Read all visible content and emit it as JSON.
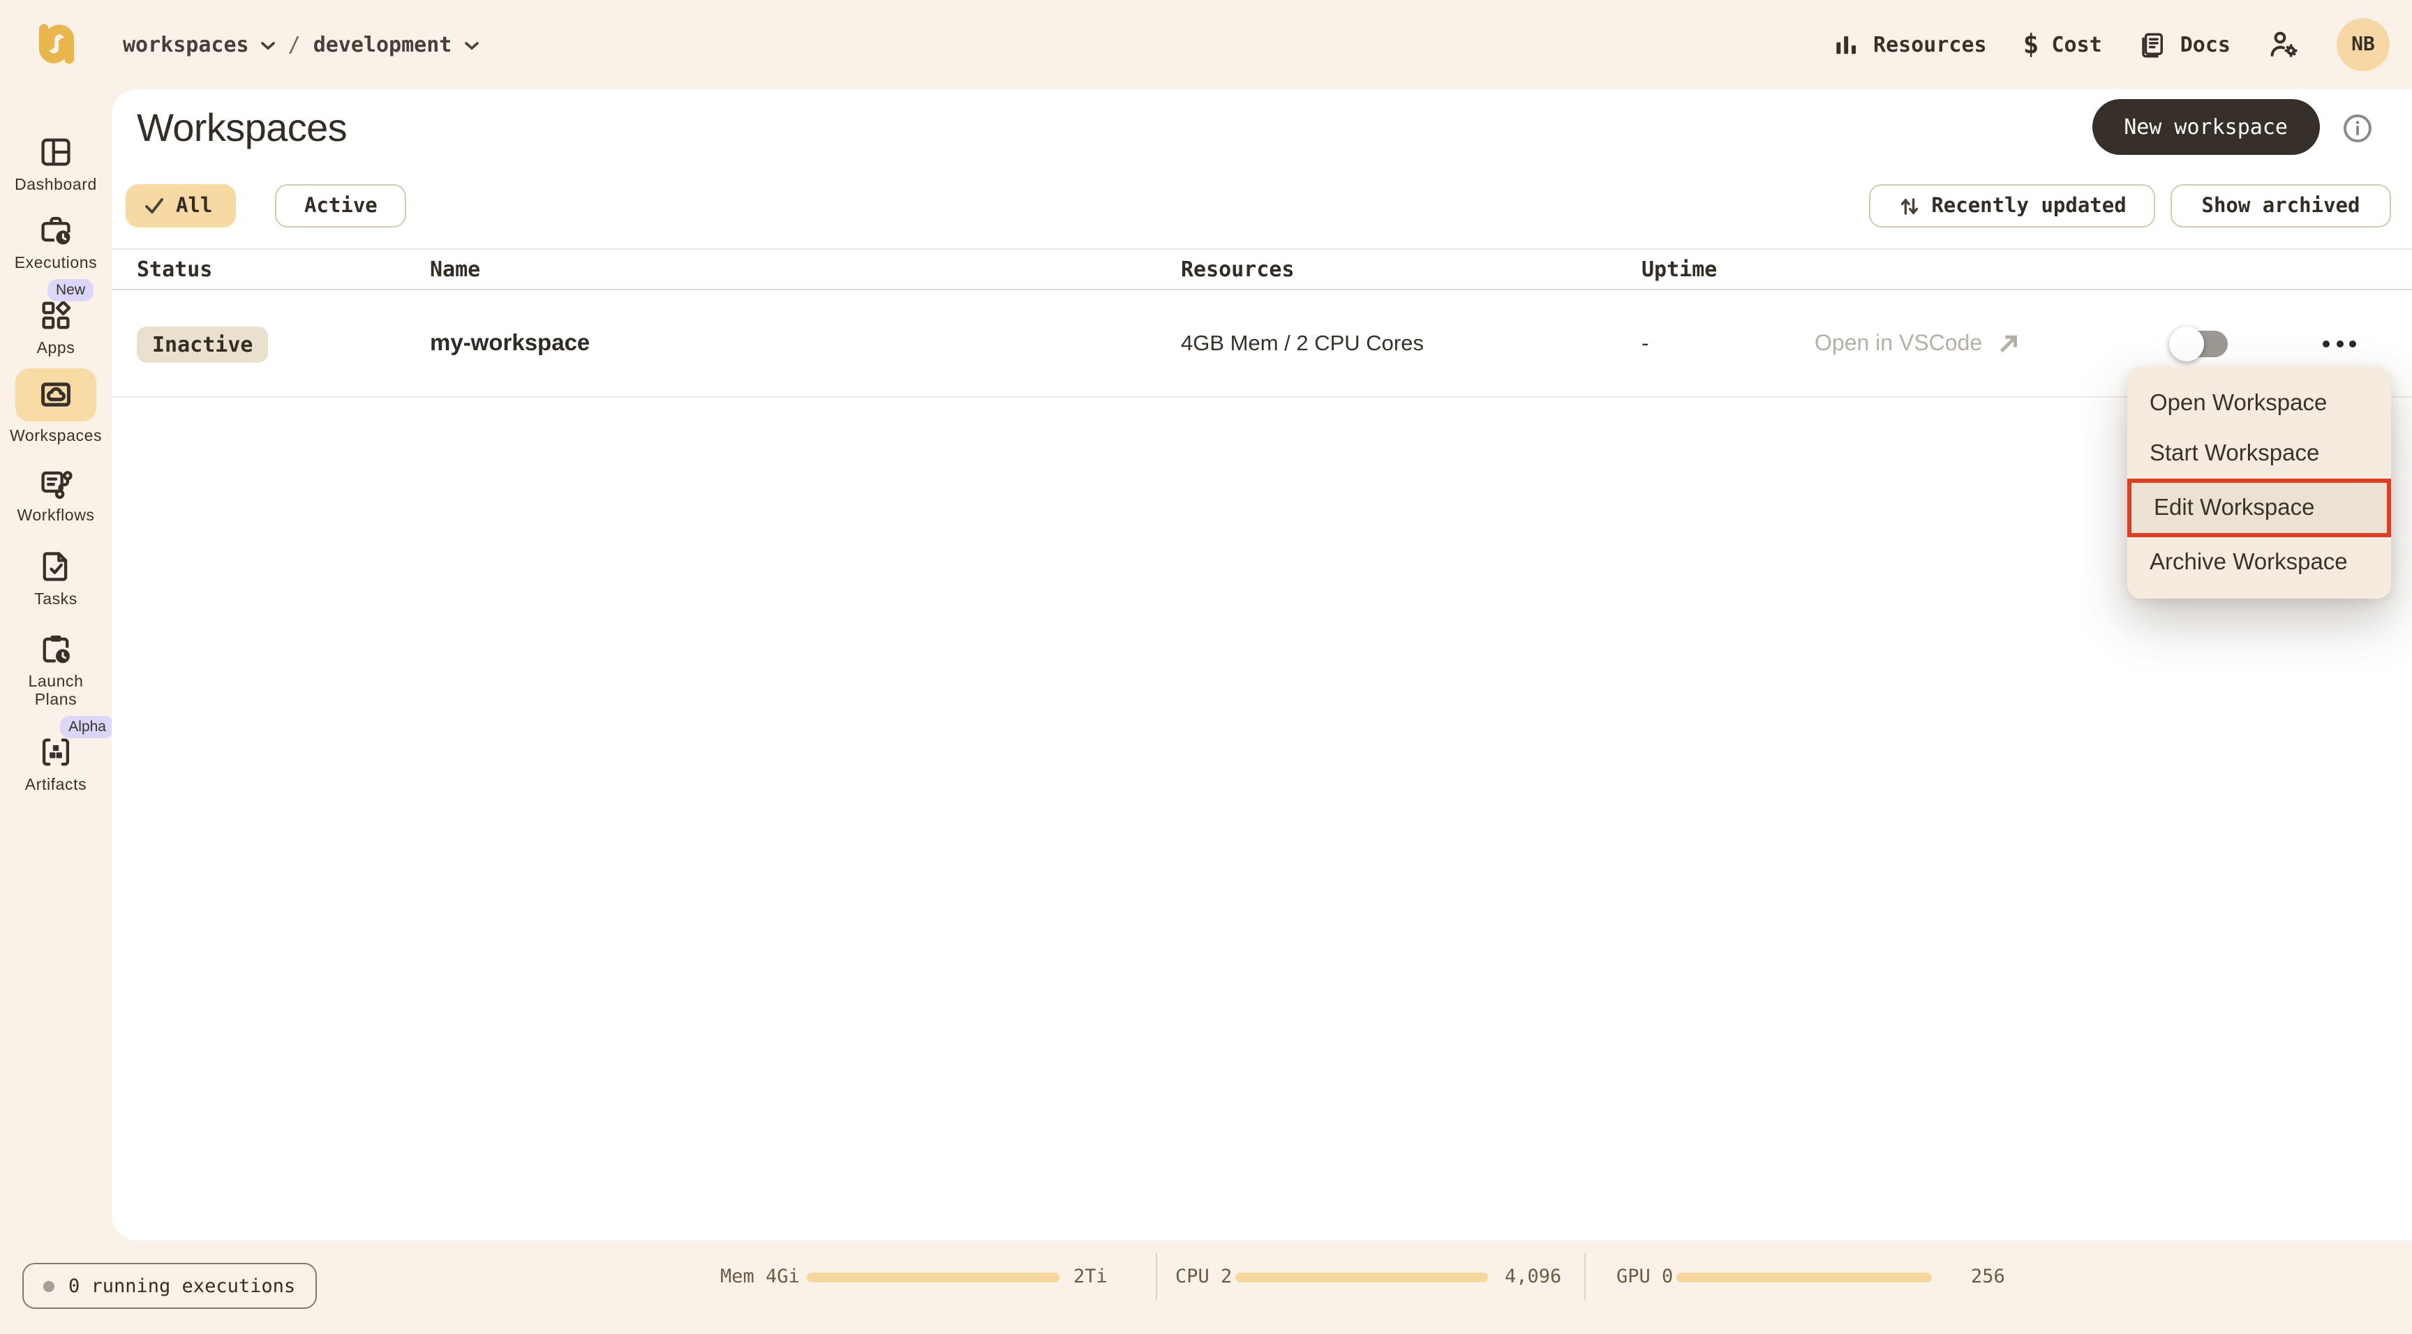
{
  "topbar": {
    "breadcrumb": {
      "workspace_label": "workspaces",
      "separator": "/",
      "project_label": "development"
    },
    "nav_resources": "Resources",
    "nav_cost": "Cost",
    "nav_docs": "Docs",
    "avatar_initials": "NB"
  },
  "sidebar": {
    "items": [
      {
        "label": "Dashboard"
      },
      {
        "label": "Executions"
      },
      {
        "label": "Apps",
        "badge": "New"
      },
      {
        "label": "Workspaces",
        "active": true
      },
      {
        "label": "Workflows"
      },
      {
        "label": "Tasks"
      },
      {
        "label": "Launch Plans"
      },
      {
        "label": "Artifacts",
        "badge": "Alpha"
      }
    ]
  },
  "main": {
    "title": "Workspaces",
    "new_workspace_button": "New workspace",
    "filter_all": "All",
    "filter_active": "Active",
    "sort_button": "Recently updated",
    "show_archived_button": "Show archived",
    "table": {
      "col_status": "Status",
      "col_name": "Name",
      "col_resources": "Resources",
      "col_uptime": "Uptime"
    },
    "row": {
      "status": "Inactive",
      "name": "my-workspace",
      "resources": "4GB Mem / 2 CPU Cores",
      "uptime": "-",
      "open_link": "Open in VSCode",
      "toggle_on": false
    }
  },
  "context_menu": {
    "open": "Open Workspace",
    "start": "Start Workspace",
    "edit": "Edit Workspace",
    "archive": "Archive Workspace",
    "highlighted_item": "Edit Workspace"
  },
  "statusbar": {
    "running_pill": "0 running executions",
    "mem_label": "Mem 4Gi",
    "mem_max": "2Ti",
    "cpu_label": "CPU 2",
    "cpu_max": "4,096",
    "gpu_label": "GPU 0",
    "gpu_max": "256"
  },
  "colors": {
    "background_cream": "#faf2e9",
    "card_white": "#ffffff",
    "ink": "#37312a",
    "logo_amber": "#e9b64b",
    "accent_amber": "#f7daa4",
    "badge_tan": "#e9e0cd",
    "lavender_badge": "#dcd7f8",
    "highlight_red": "#e13d25",
    "menu_bg": "#f5ebdf",
    "menu_highlight_bg": "#ece2d3",
    "meter_fill": "#f6d89d"
  }
}
